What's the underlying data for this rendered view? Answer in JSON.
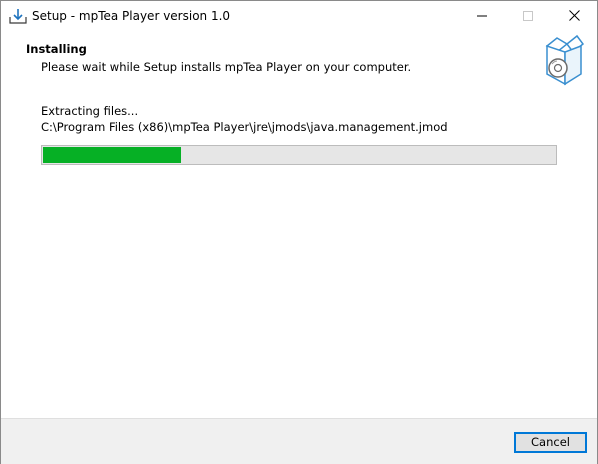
{
  "window": {
    "title": "Setup - mpTea Player version 1.0",
    "icons": {
      "app": "installer-download-icon",
      "minimize": "minimize-icon",
      "maximize": "maximize-icon",
      "close": "close-icon"
    }
  },
  "header": {
    "title": "Installing",
    "subtitle": "Please wait while Setup installs mpTea Player on your computer.",
    "art": "box-with-disc-icon"
  },
  "body": {
    "status": "Extracting files...",
    "file_path": "C:\\Program Files (x86)\\mpTea Player\\jre\\jmods\\java.management.jmod",
    "progress_fraction": 0.27
  },
  "footer": {
    "cancel_label": "Cancel"
  },
  "colors": {
    "progress_fill": "#06b025",
    "progress_track": "#e6e6e6",
    "focus_border": "#0078d7",
    "footer_bg": "#f0f0f0"
  }
}
